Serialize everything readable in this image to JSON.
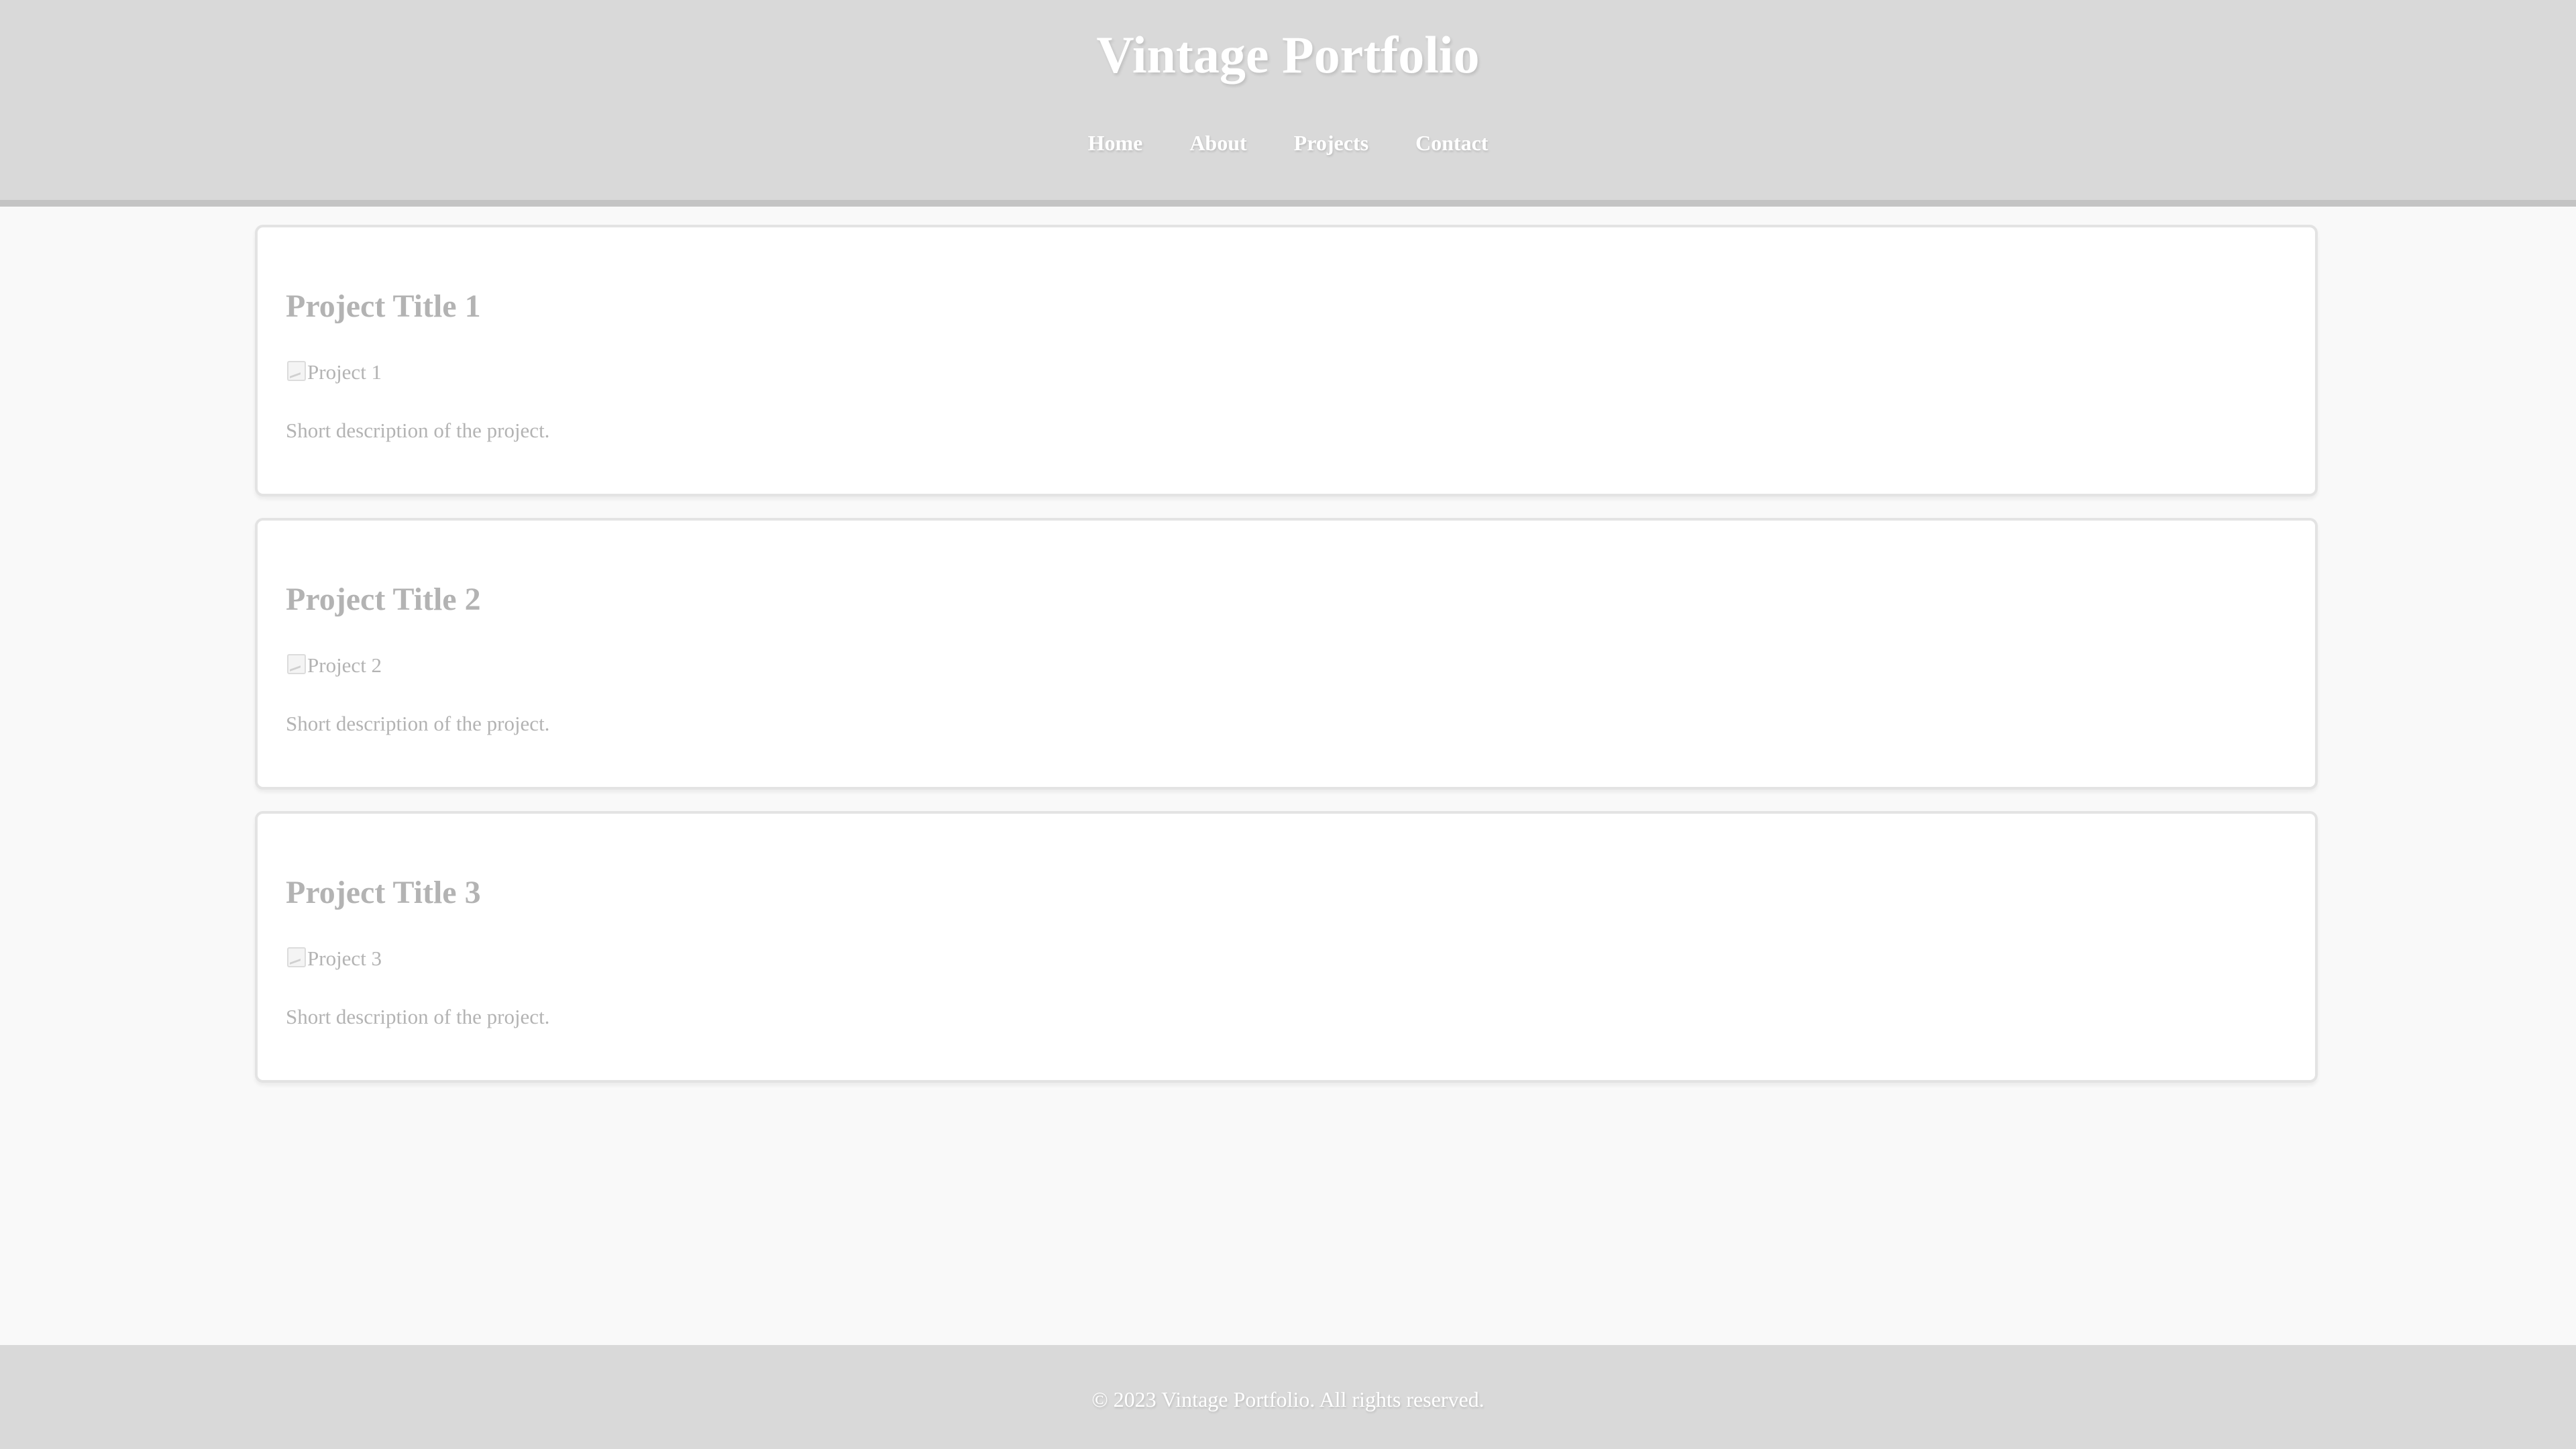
{
  "header": {
    "title": "Vintage Portfolio",
    "nav": [
      {
        "label": "Home"
      },
      {
        "label": "About"
      },
      {
        "label": "Projects"
      },
      {
        "label": "Contact"
      }
    ]
  },
  "projects": [
    {
      "title": "Project Title 1",
      "image_alt": "Project 1",
      "description": "Short description of the project."
    },
    {
      "title": "Project Title 2",
      "image_alt": "Project 2",
      "description": "Short description of the project."
    },
    {
      "title": "Project Title 3",
      "image_alt": "Project 3",
      "description": "Short description of the project."
    }
  ],
  "footer": {
    "copyright": "© 2023 Vintage Portfolio. All rights reserved."
  },
  "colors": {
    "header_bg": "#d9d9d9",
    "page_bg": "#f9f9f9",
    "card_bg": "#ffffff",
    "muted_text": "#b3b3b3",
    "header_text": "#ffffff"
  },
  "icons": {
    "project_image": "broken-image-icon"
  }
}
